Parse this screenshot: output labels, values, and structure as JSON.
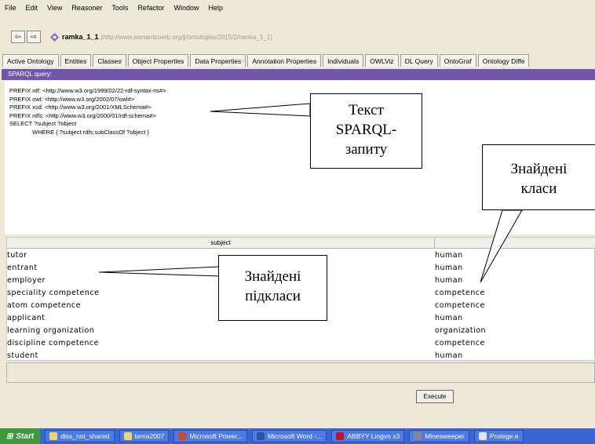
{
  "menu": [
    "File",
    "Edit",
    "View",
    "Reasoner",
    "Tools",
    "Refactor",
    "Window",
    "Help"
  ],
  "ontology": {
    "name": "ramka_1_1",
    "uri": "(http://www.semanticweb.org/jj/ontologies/2015/2/ramka_1_1)"
  },
  "tabs": [
    "Active Ontology",
    "Entities",
    "Classes",
    "Object Properties",
    "Data Properties",
    "Annotation Properties",
    "Individuals",
    "OWLViz",
    "DL Query",
    "OntoGraf",
    "Ontology Diffe"
  ],
  "sparql_header": "SPARQL query:",
  "query_lines": [
    "PREFIX rdf: <http://www.w3.org/1999/02/22-rdf-syntax-ns#>",
    "PREFIX owl: <http://www.w3.org/2002/07/owl#>",
    "PREFIX xsd: <http://www.w3.org/2001/XMLSchema#>",
    "PREFIX rdfs: <http://www.w3.org/2000/01/rdf-schema#>",
    "SELECT ?subject ?object",
    "              WHERE { ?subject rdfs:subClassOf ?object }"
  ],
  "table": {
    "headers": [
      "subject",
      ""
    ],
    "rows": [
      [
        "tutor",
        "human"
      ],
      [
        "entrant",
        "human"
      ],
      [
        "employer",
        "human"
      ],
      [
        "speciality competence",
        "competence"
      ],
      [
        "atom competence",
        "competence"
      ],
      [
        "applicant",
        "human"
      ],
      [
        "learning organization",
        "organization"
      ],
      [
        "discipline competence",
        "competence"
      ],
      [
        "student",
        "human"
      ]
    ]
  },
  "execute_label": "Execute",
  "callouts": {
    "query_text": [
      "Текст",
      "SPARQL-",
      "запиту"
    ],
    "found_classes": [
      "Знайдені",
      "класи"
    ],
    "found_subclasses": [
      "Знайдені",
      "підкласи"
    ]
  },
  "taskbar": {
    "start": "Start",
    "items": [
      "diss_not_shared",
      "tema2007",
      "Microsoft Power...",
      "Microsoft Word -...",
      "ABBYY Lingvo x3",
      "Minesweeper",
      "Protege.e"
    ]
  },
  "colors": {
    "accent": "#7155aa",
    "taskbar": "#3a66d4",
    "start": "#3c9a3c"
  }
}
